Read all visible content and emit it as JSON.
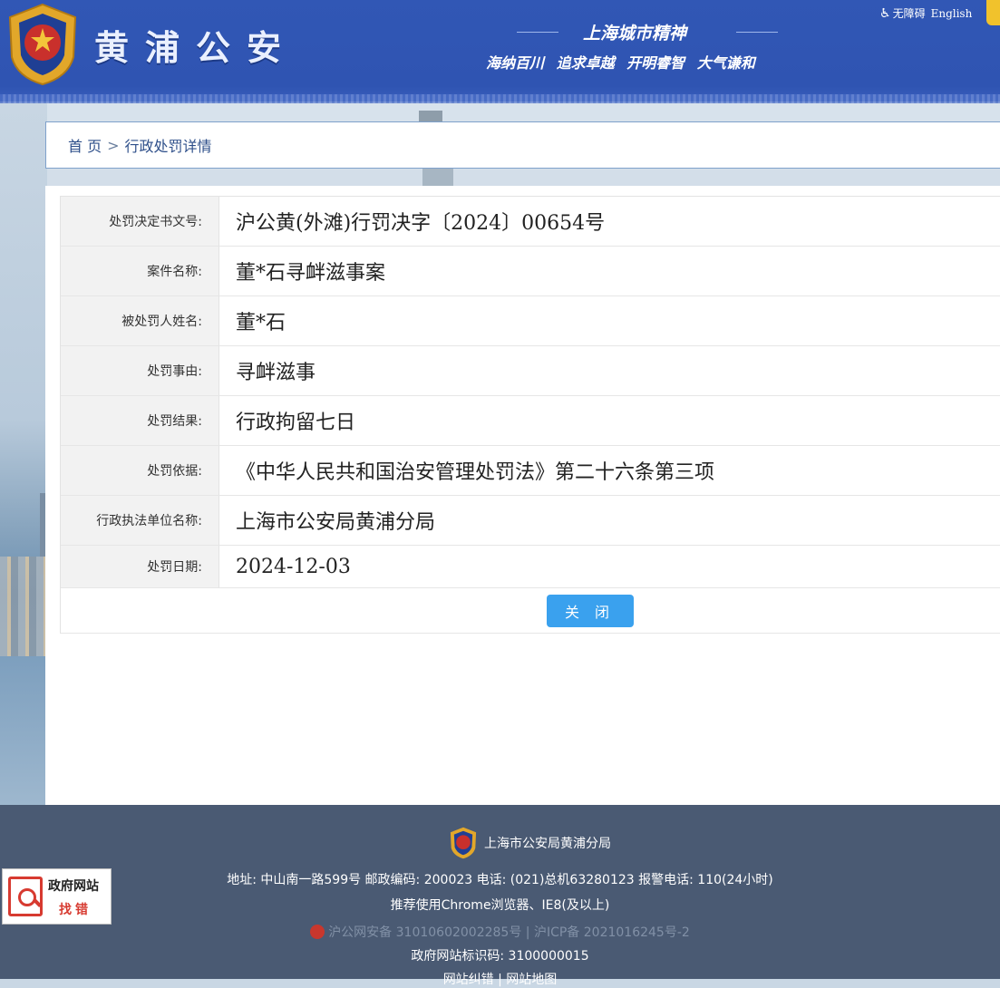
{
  "header": {
    "site_title": "黄浦公安",
    "slogan_title": "上海城市精神",
    "slogan_sub": "海纳百川 追求卓越 开明睿智 大气谦和",
    "accessibility_label": "无障碍",
    "english_label": "English"
  },
  "breadcrumb": {
    "home": "首 页",
    "separator": ">",
    "current": "行政处罚详情"
  },
  "details": [
    {
      "label": "处罚决定书文号:",
      "value": "沪公黄(外滩)行罚决字〔2024〕00654号"
    },
    {
      "label": "案件名称:",
      "value": "董*石寻衅滋事案"
    },
    {
      "label": "被处罚人姓名:",
      "value": "董*石"
    },
    {
      "label": "处罚事由:",
      "value": "寻衅滋事"
    },
    {
      "label": "处罚结果:",
      "value": "行政拘留七日"
    },
    {
      "label": "处罚依据:",
      "value": "《中华人民共和国治安管理处罚法》第二十六条第三项"
    },
    {
      "label": "行政执法单位名称:",
      "value": "上海市公安局黄浦分局"
    },
    {
      "label": "处罚日期:",
      "value": "2024-12-03"
    }
  ],
  "close_button": "关 闭",
  "footer": {
    "org_name": "上海市公安局黄浦分局",
    "address_line": "地址: 中山南一路599号 邮政编码: 200023 电话: (021)总机63280123 报警电话: 110(24小时)",
    "browser_line": "推荐使用Chrome浏览器、IE8(及以上)",
    "beian_line": "沪公网安备 31010602002285号 | 沪ICP备 2021016245号-2",
    "site_code_line": "政府网站标识码: 3100000015",
    "links_line": "网站纠错 | 网站地图",
    "report_title": "政府网站",
    "report_action": "找错"
  },
  "colors": {
    "header_blue": "#3157b5",
    "button_blue": "#3aa1ee",
    "footer_slate": "#4a5a73",
    "accent_red": "#d73a30"
  }
}
